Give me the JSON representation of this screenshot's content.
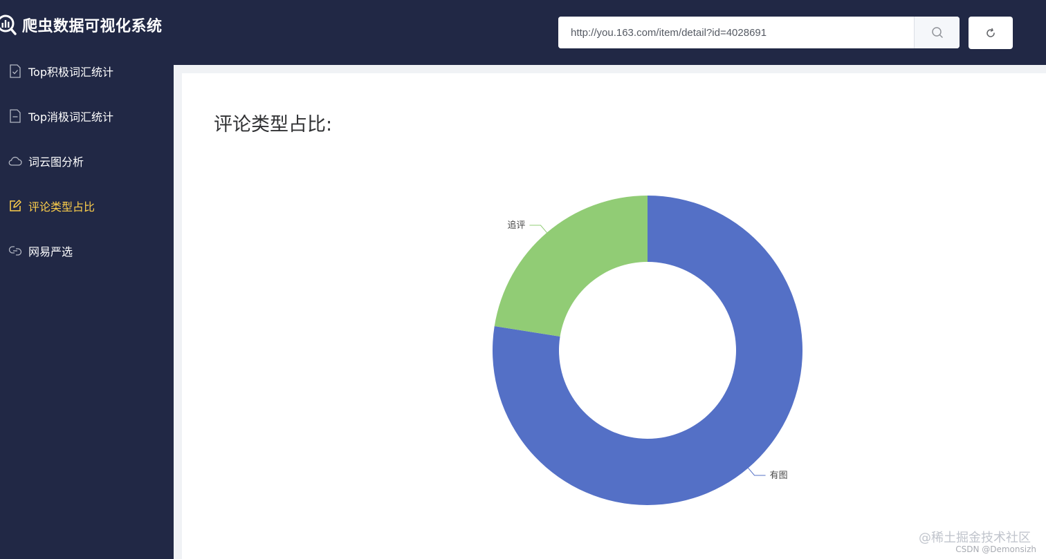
{
  "app": {
    "title": "爬虫数据可视化系统"
  },
  "header": {
    "search_value": "http://you.163.com/item/detail?id=4028691",
    "search_icon": "search-icon",
    "refresh_icon": "refresh-icon"
  },
  "sidebar": {
    "items": [
      {
        "label": "Top积极词汇统计",
        "icon": "document-check-icon",
        "active": false
      },
      {
        "label": "Top消极词汇统计",
        "icon": "document-remove-icon",
        "active": false
      },
      {
        "label": "词云图分析",
        "icon": "cloud-icon",
        "active": false
      },
      {
        "label": "评论类型占比",
        "icon": "edit-icon",
        "active": true
      },
      {
        "label": "网易严选",
        "icon": "link-icon",
        "active": false
      }
    ],
    "active_color": "#ffd04b",
    "background": "#212845"
  },
  "main": {
    "title": "评论类型占比:"
  },
  "chart_data": {
    "type": "pie",
    "donut": true,
    "title": "",
    "slices": [
      {
        "label": "有图",
        "value": 77.5,
        "color": "#5470c6"
      },
      {
        "label": "追评",
        "value": 22.5,
        "color": "#91cc75"
      }
    ]
  },
  "watermark": {
    "line1": "@稀土掘金技术社区",
    "line2": "CSDN @Demonsizh"
  }
}
